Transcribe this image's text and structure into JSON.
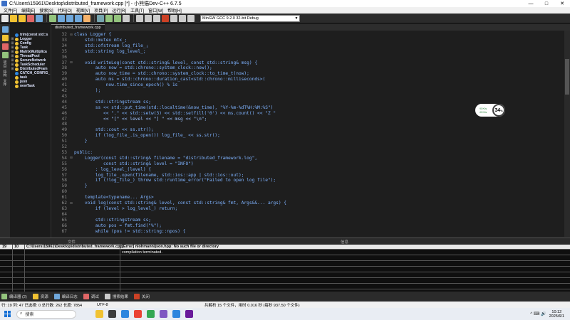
{
  "window": {
    "title": "C:\\Users\\15961\\Desktop\\distributed_framework.cpp [*] - 小熊猫Dev-C++ 6.7.5",
    "minimize": "—",
    "maximize": "□",
    "close": "✕"
  },
  "menu": [
    "文件[F]",
    "编辑[E]",
    "搜索[S]",
    "代码[O]",
    "视图[V]",
    "项目[P]",
    "运行[R]",
    "工具[T]",
    "窗口[W]",
    "帮助[H]"
  ],
  "toolbar": {
    "compiler": "MinGW GCC 9.2.0 32-bit Debug",
    "button_colors": [
      "#e8e8e8",
      "#f1c232",
      "#f1c232",
      "#e06666",
      "#6fa8dc",
      "#93c47d",
      "#6fa8dc",
      "#6fa8dc",
      "#6fa8dc",
      "#f6b26b",
      "#76a5af",
      "#93c47d",
      "#93c47d",
      "#cccccc",
      "#cccccc",
      "#cccccc",
      "#cccccc",
      "#cc4125",
      "#cccccc",
      "#cccccc",
      "#cccccc"
    ]
  },
  "vtabs": {
    "icons": [
      "#6fa8dc",
      "#f1c232",
      "#e06666",
      "#93c47d"
    ],
    "labels": [
      "项目",
      "结构",
      "文件"
    ]
  },
  "class_browser": {
    "items": [
      {
        "label": "trim(const std::s",
        "color": "#2e86de",
        "expandable": false
      },
      {
        "label": "Logger",
        "color": "#f1c232",
        "expandable": true
      },
      {
        "label": "Config",
        "color": "#f1c232",
        "expandable": true
      },
      {
        "label": "Task",
        "color": "#f1c232",
        "expandable": true
      },
      {
        "label": "MatrixMultiplica",
        "color": "#f1c232",
        "expandable": true
      },
      {
        "label": "ThreadPool",
        "color": "#f1c232",
        "expandable": true
      },
      {
        "label": "SecureNetwork",
        "color": "#f1c232",
        "expandable": true
      },
      {
        "label": "TaskScheduler",
        "color": "#f1c232",
        "expandable": true
      },
      {
        "label": "DistributedFram",
        "color": "#f1c232",
        "expandable": true
      },
      {
        "label": "CATCH_CONFIG_",
        "color": "#2e86de",
        "expandable": false
      },
      {
        "label": "task",
        "color": "#f1c232",
        "expandable": false
      },
      {
        "label": "json",
        "color": "#f1c232",
        "expandable": false
      },
      {
        "label": "newTask",
        "color": "#f1c232",
        "expandable": false
      }
    ]
  },
  "editor": {
    "tab": "distributed_framework.cpp",
    "lines": [
      {
        "n": "32",
        "fold": "⊟",
        "text": "class Logger {"
      },
      {
        "n": "33",
        "fold": "",
        "text": "    std::mutex mtx_;"
      },
      {
        "n": "34",
        "fold": "",
        "text": "    std::ofstream log_file_;"
      },
      {
        "n": "35",
        "fold": "",
        "text": "    std::string log_level_;"
      },
      {
        "n": "36",
        "fold": "",
        "text": ""
      },
      {
        "n": "37",
        "fold": "⊟",
        "text": "    void writeLog(const std::string& level, const std::string& msg) {"
      },
      {
        "n": "38",
        "fold": "",
        "text": "        auto now = std::chrono::system_clock::now();"
      },
      {
        "n": "39",
        "fold": "",
        "text": "        auto now_time = std::chrono::system_clock::to_time_t(now);"
      },
      {
        "n": "40",
        "fold": "",
        "text": "        auto ms = std::chrono::duration_cast<std::chrono::milliseconds>("
      },
      {
        "n": "41",
        "fold": "",
        "text": "            now.time_since_epoch() % 1s"
      },
      {
        "n": "42",
        "fold": "",
        "text": "        );"
      },
      {
        "n": "43",
        "fold": "",
        "text": ""
      },
      {
        "n": "44",
        "fold": "",
        "text": "        std::stringstream ss;"
      },
      {
        "n": "45",
        "fold": "",
        "text": "        ss << std::put_time(std::localtime(&now_time), \"%Y-%m-%dT%H:%M:%S\")"
      },
      {
        "n": "46",
        "fold": "",
        "text": "           << \".\" << std::setw(3) << std::setfill('0') << ms.count() << \"Z \""
      },
      {
        "n": "47",
        "fold": "",
        "text": "           << \"[\" << level << \"] \" << msg << \"\\n\";"
      },
      {
        "n": "48",
        "fold": "",
        "text": ""
      },
      {
        "n": "49",
        "fold": "",
        "text": "        std::cout << ss.str();"
      },
      {
        "n": "50",
        "fold": "",
        "text": "        if (log_file_.is_open()) log_file_ << ss.str();"
      },
      {
        "n": "51",
        "fold": "",
        "text": "    }"
      },
      {
        "n": "52",
        "fold": "",
        "text": ""
      },
      {
        "n": "53",
        "fold": "",
        "text": "public:"
      },
      {
        "n": "54",
        "fold": "⊟",
        "text": "    Logger(const std::string& filename = \"distributed_framework.log\","
      },
      {
        "n": "55",
        "fold": "",
        "text": "           const std::string& level = \"INFO\")"
      },
      {
        "n": "56",
        "fold": "",
        "text": "        : log_level_(level) {"
      },
      {
        "n": "57",
        "fold": "",
        "text": "        log_file_.open(filename, std::ios::app | std::ios::out);"
      },
      {
        "n": "58",
        "fold": "",
        "text": "        if (!log_file_) throw std::runtime_error(\"Failed to open log file\");"
      },
      {
        "n": "59",
        "fold": "",
        "text": "    }"
      },
      {
        "n": "60",
        "fold": "",
        "text": ""
      },
      {
        "n": "61",
        "fold": "",
        "text": "    template<typename... Args>"
      },
      {
        "n": "62",
        "fold": "⊟",
        "text": "    void log(const std::string& level, const std::string& fmt, Args&&... args) {"
      },
      {
        "n": "63",
        "fold": "",
        "text": "        if (level > log_level_) return;"
      },
      {
        "n": "64",
        "fold": "",
        "text": ""
      },
      {
        "n": "65",
        "fold": "",
        "text": "        std::stringstream ss;"
      },
      {
        "n": "66",
        "fold": "",
        "text": "        auto pos = fmt.find(\"%\");"
      },
      {
        "n": "67",
        "fold": "",
        "text": "        while (pos != std::string::npos) {"
      }
    ]
  },
  "gauge": {
    "up": "↑0  K/s",
    "down": "↓0  K/s",
    "value": "34",
    "unit": "%"
  },
  "output": {
    "header": {
      "col_file": "文件",
      "col_info": "信息"
    },
    "rows": [
      {
        "line": "19",
        "col": "10",
        "file": "C:\\Users\\15961\\Desktop\\distributed_framework.cpp",
        "msg": "[Error] nlohmann/json.hpp: No such file or directory",
        "selected": true
      },
      {
        "line": "",
        "col": "",
        "file": "",
        "msg": "compilation terminated.",
        "selected": false
      }
    ]
  },
  "bottom_tabs": [
    {
      "label": "编译器 (2)",
      "color": "#93c47d"
    },
    {
      "label": "资源",
      "color": "#f1c232"
    },
    {
      "label": "编译日志",
      "color": "#6fa8dc"
    },
    {
      "label": "调试",
      "color": "#e06666"
    },
    {
      "label": "搜索结果",
      "color": "#cccccc"
    },
    {
      "label": "关闭",
      "color": "#cc4125"
    }
  ],
  "status": {
    "position": "行: 19  列: 47  已选择: 0  总行数: 262  长度: 7854",
    "encoding": "UTF-8",
    "parse": "共解析 15 个文件，用时 0.016 秒 (每秒 937.50 个文件)"
  },
  "taskbar": {
    "search": "搜索",
    "apps": [
      "#f1c232",
      "#3d3d3d",
      "#2e86de",
      "#ea4335",
      "#34a853",
      "#7e57c2",
      "#2e86de",
      "#6a1b9a"
    ],
    "time": "10:12",
    "date": "2025/6/1",
    "tray": "^  ⌨  🔊"
  }
}
